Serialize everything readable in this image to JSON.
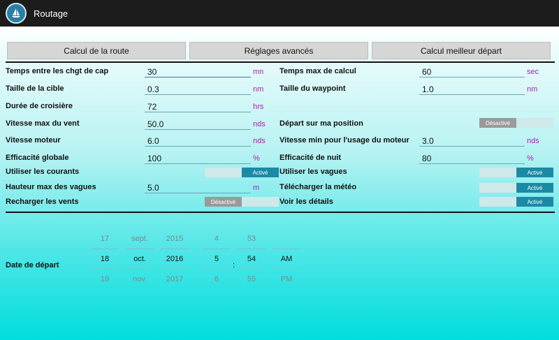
{
  "titlebar": {
    "title": "Routage"
  },
  "buttons": {
    "calc_route": "Calcul de la route",
    "advanced": "Réglages avancés",
    "best_departure": "Calcul meilleur départ"
  },
  "left": [
    {
      "label": "Temps entre les chgt de cap",
      "value": "30",
      "unit": "mn"
    },
    {
      "label": "Taille de la cible",
      "value": "0.3",
      "unit": "nm"
    },
    {
      "label": "Durée de croisière",
      "value": "72",
      "unit": "hrs"
    },
    {
      "label": "Vitesse max du vent",
      "value": "50.0",
      "unit": "nds"
    },
    {
      "label": "Vitesse moteur",
      "value": "6.0",
      "unit": "nds"
    },
    {
      "label": "Efficacité globale",
      "value": "100",
      "unit": "%"
    },
    {
      "label": "Utiliser les courants",
      "toggle": "Activé",
      "state": "on"
    },
    {
      "label": "Hauteur max des vagues",
      "value": "5.0",
      "unit": "m"
    },
    {
      "label": "Recharger les vents",
      "toggle": "Désactivé",
      "state": "off"
    }
  ],
  "right": [
    {
      "label": "Temps max de calcul",
      "value": "60",
      "unit": "sec"
    },
    {
      "label": "Taille du waypoint",
      "value": "1.0",
      "unit": "nm"
    },
    {
      "label": "Départ sur ma position",
      "toggle": "Désactivé",
      "state": "off"
    },
    {
      "label": "Vitesse min pour l'usage du moteur",
      "value": "3.0",
      "unit": "nds"
    },
    {
      "label": "Efficacité de nuit",
      "value": "80",
      "unit": "%"
    },
    {
      "label": "Utiliser les vagues",
      "toggle": "Activé",
      "state": "on"
    },
    {
      "label": "Télécharger la météo",
      "toggle": "Activé",
      "state": "on"
    },
    {
      "label": "Voir les détails",
      "toggle": "Activé",
      "state": "on"
    }
  ],
  "departure": {
    "label": "Date de départ",
    "day": {
      "prev": "17",
      "cur": "18",
      "next": "19"
    },
    "month": {
      "prev": "sept.",
      "cur": "oct.",
      "next": "nov."
    },
    "year": {
      "prev": "2015",
      "cur": "2016",
      "next": "2017"
    },
    "hour": {
      "prev": "4",
      "cur": "5",
      "next": "6"
    },
    "minute": {
      "prev": "53",
      "cur": "54",
      "next": "55"
    },
    "ampm": {
      "prev": "",
      "cur": "AM",
      "next": "PM"
    },
    "separator": ":"
  }
}
